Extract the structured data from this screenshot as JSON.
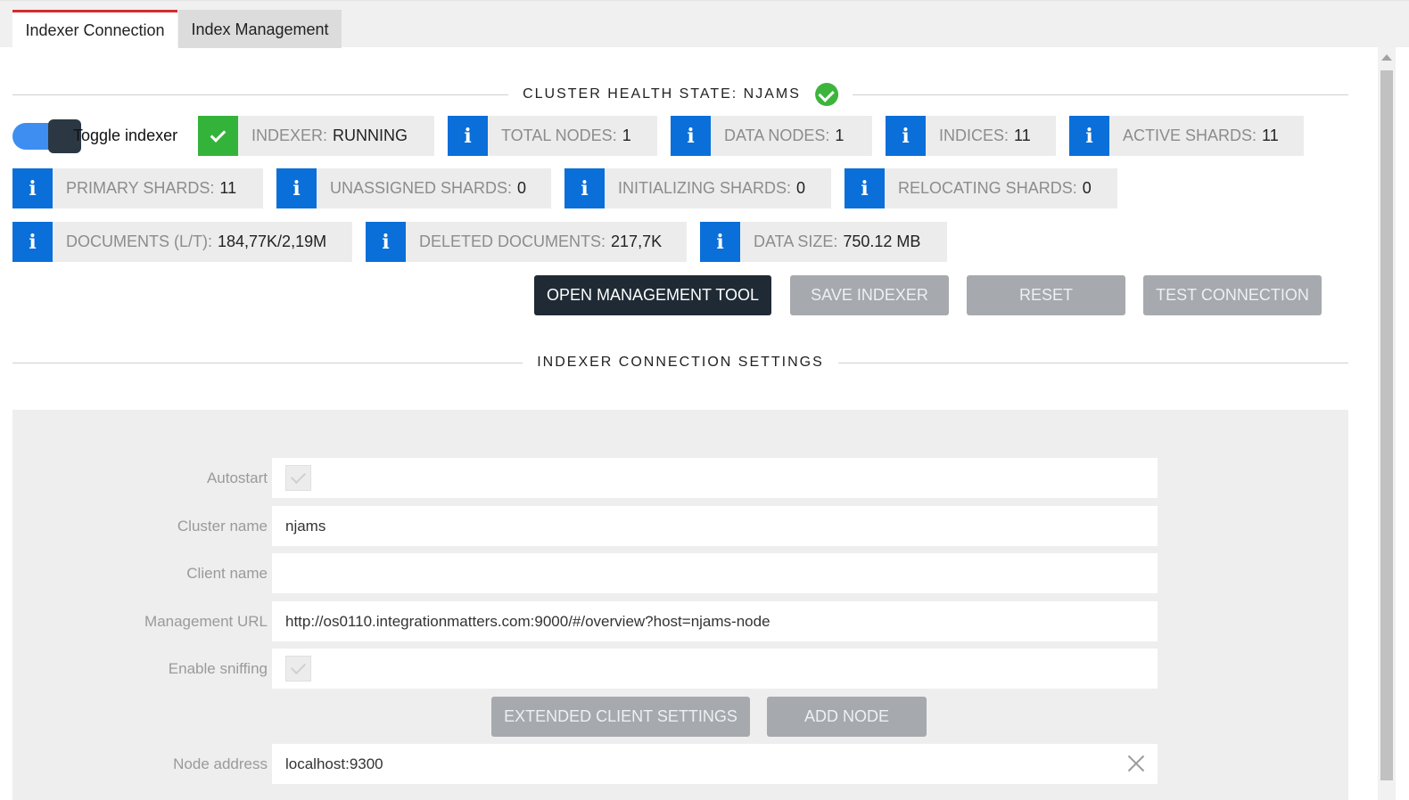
{
  "tabs": [
    {
      "label": "Indexer Connection",
      "active": true
    },
    {
      "label": "Index Management",
      "active": false
    }
  ],
  "cluster": {
    "title": "CLUSTER HEALTH STATE: NJAMS",
    "health_icon": "check-circle-icon",
    "health_color": "#3cb53c"
  },
  "toggle": {
    "label": "Toggle indexer",
    "enabled": true
  },
  "stats": {
    "indexer": {
      "label": "INDEXER:",
      "value": "RUNNING"
    },
    "total_nodes": {
      "label": "TOTAL NODES:",
      "value": "1"
    },
    "data_nodes": {
      "label": "DATA NODES:",
      "value": "1"
    },
    "indices": {
      "label": "INDICES:",
      "value": "11"
    },
    "active_shards": {
      "label": "ACTIVE SHARDS:",
      "value": "11"
    },
    "primary_shards": {
      "label": "PRIMARY SHARDS:",
      "value": "11"
    },
    "unassigned_shards": {
      "label": "UNASSIGNED SHARDS:",
      "value": "0"
    },
    "initializing_shards": {
      "label": "INITIALIZING SHARDS:",
      "value": "0"
    },
    "relocating_shards": {
      "label": "RELOCATING SHARDS:",
      "value": "0"
    },
    "documents": {
      "label": "DOCUMENTS (L/T):",
      "value": "184,77K/2,19M"
    },
    "deleted_documents": {
      "label": "DELETED DOCUMENTS:",
      "value": "217,7K"
    },
    "data_size": {
      "label": "DATA SIZE:",
      "value": "750.12 MB"
    }
  },
  "info_icon_glyph": "i",
  "actions": {
    "open_management": "OPEN MANAGEMENT TOOL",
    "save_indexer": "SAVE INDEXER",
    "reset": "RESET",
    "test_connection": "TEST CONNECTION"
  },
  "settings": {
    "title": "INDEXER CONNECTION SETTINGS",
    "autostart": {
      "label": "Autostart",
      "checked": true
    },
    "cluster_name": {
      "label": "Cluster name",
      "value": "njams"
    },
    "client_name": {
      "label": "Client name",
      "value": ""
    },
    "management_url": {
      "label": "Management URL",
      "value": "http://os0110.integrationmatters.com:9000/#/overview?host=njams-node"
    },
    "enable_sniffing": {
      "label": "Enable sniffing",
      "checked": true
    },
    "extended_client_settings": "EXTENDED CLIENT SETTINGS",
    "add_node": "ADD NODE",
    "node_address": {
      "label": "Node address",
      "value": "localhost:9300"
    }
  },
  "colors": {
    "accent_tab": "#d52b2b",
    "info_blue": "#0a6fd9",
    "ok_green": "#34b33a",
    "dark_button": "#1f2a35",
    "gray_button": "#a6a9ad"
  }
}
